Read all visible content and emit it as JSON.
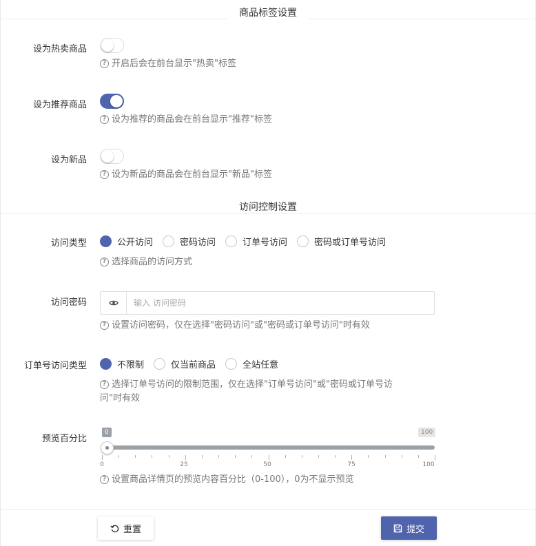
{
  "sections": {
    "tags_title": "商品标签设置",
    "access_title": "访问控制设置"
  },
  "hot": {
    "label": "设为热卖商品",
    "enabled": false,
    "help": "开启后会在前台显示\"热卖\"标签"
  },
  "recommend": {
    "label": "设为推荐商品",
    "enabled": true,
    "help": "设为推荐的商品会在前台显示\"推荐\"标签"
  },
  "new_item": {
    "label": "设为新品",
    "enabled": false,
    "help": "设为新品的商品会在前台显示\"新品\"标签"
  },
  "access_type": {
    "label": "访问类型",
    "options": [
      "公开访问",
      "密码访问",
      "订单号访问",
      "密码或订单号访问"
    ],
    "selected": "公开访问",
    "help": "选择商品的访问方式"
  },
  "access_password": {
    "label": "访问密码",
    "value": "",
    "placeholder": "输入 访问密码",
    "help": "设置访问密码，仅在选择\"密码访问\"或\"密码或订单号访问\"时有效"
  },
  "order_access_type": {
    "label": "订单号访问类型",
    "options": [
      "不限制",
      "仅当前商品",
      "全站任意"
    ],
    "selected": "不限制",
    "help_line1": "选择订单号访问的限制范围，仅在选择\"订单号访问\"或\"密码或订单号访",
    "help_line2": "问\"时有效"
  },
  "preview": {
    "label": "预览百分比",
    "value": 0,
    "min_label": "0",
    "max_label": "100",
    "tick_labels": [
      "0",
      "25",
      "50",
      "75",
      "100"
    ],
    "help": "设置商品详情页的预览内容百分比（0-100），0为不显示预览"
  },
  "buttons": {
    "reset": "重置",
    "submit": "提交"
  },
  "colors": {
    "accent": "#5063ad",
    "track": "#9aa2a8"
  }
}
